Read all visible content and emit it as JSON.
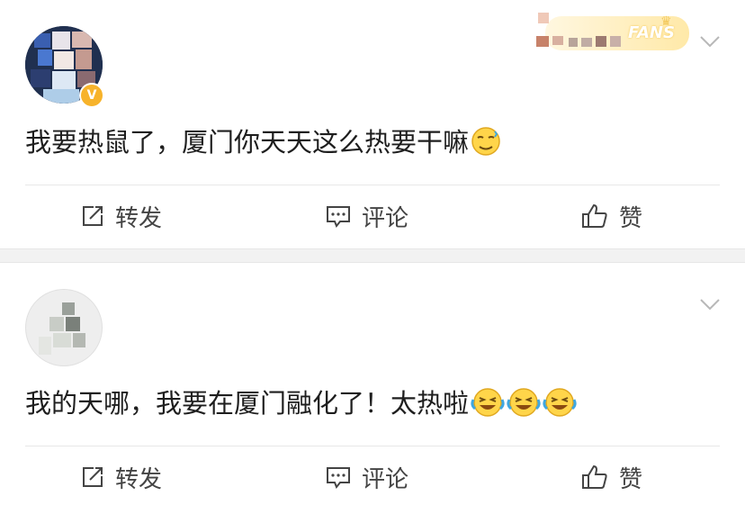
{
  "posts": [
    {
      "text": "我要热鼠了，厦门你天天这么热要干嘛",
      "badge_text": "FANS",
      "emojis": [
        "hot-face-emoji"
      ],
      "actions": {
        "share": "转发",
        "comment": "评论",
        "like": "赞"
      }
    },
    {
      "text": "我的天哪，我要在厦门融化了！太热啦",
      "emojis": [
        "laughing-crying-emoji",
        "laughing-crying-emoji",
        "laughing-crying-emoji"
      ],
      "actions": {
        "share": "转发",
        "comment": "评论",
        "like": "赞"
      }
    }
  ],
  "colors": {
    "text": "#1e1e1e",
    "action_text": "#444444",
    "divider": "#e8e8e8",
    "separator": "#f2f2f2",
    "verified_badge": "#f7b32b",
    "emoji_yellow": "#ffd54a"
  },
  "icons": {
    "share": "share-icon",
    "comment": "comment-icon",
    "like": "thumbs-up-icon",
    "more": "chevron-down-icon",
    "verified": "verified-v-icon"
  }
}
